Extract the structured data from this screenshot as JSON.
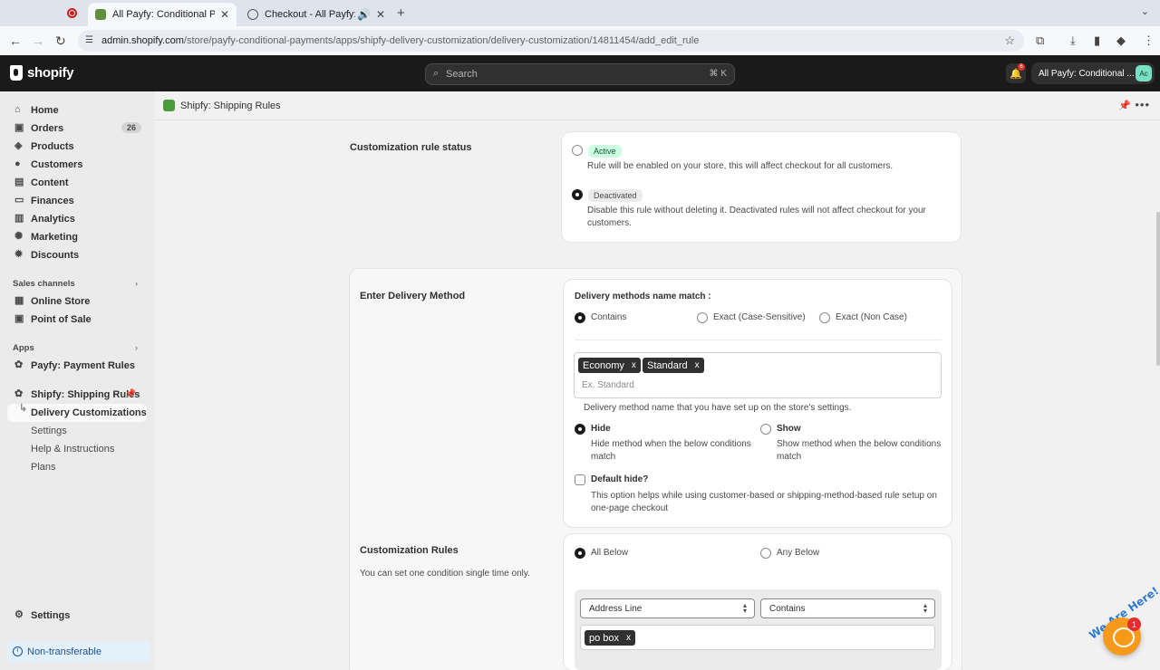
{
  "browser": {
    "tabs": [
      {
        "title": "All Payfy: Conditional Payment",
        "active": true
      },
      {
        "title": "Checkout - All Payfy: Con",
        "active": false
      }
    ],
    "url_host": "admin.shopify.com",
    "url_path": "/store/payfy-conditional-payments/apps/shipfy-delivery-customization/delivery-customization/14811454/add_edit_rule"
  },
  "topbar": {
    "logo_text": "shopify",
    "search_placeholder": "Search",
    "search_shortcut": "⌘ K",
    "notification_count": "6",
    "store_name": "All Payfy: Conditional ...",
    "avatar_initials": "Ac"
  },
  "sidebar": {
    "items": [
      {
        "label": "Home",
        "icon": "home-icon"
      },
      {
        "label": "Orders",
        "icon": "orders-icon",
        "badge": "26"
      },
      {
        "label": "Products",
        "icon": "products-icon"
      },
      {
        "label": "Customers",
        "icon": "customers-icon"
      },
      {
        "label": "Content",
        "icon": "content-icon"
      },
      {
        "label": "Finances",
        "icon": "finances-icon"
      },
      {
        "label": "Analytics",
        "icon": "analytics-icon"
      },
      {
        "label": "Marketing",
        "icon": "marketing-icon"
      },
      {
        "label": "Discounts",
        "icon": "discounts-icon"
      }
    ],
    "sales_channels_label": "Sales channels",
    "sales_channels": [
      {
        "label": "Online Store",
        "icon": "store-icon"
      },
      {
        "label": "Point of Sale",
        "icon": "pos-icon"
      }
    ],
    "apps_label": "Apps",
    "apps": [
      {
        "label": "Payfy: Payment Rules",
        "icon": "payfy-icon"
      },
      {
        "label": "Shipfy: Shipping Rules",
        "icon": "shipfy-icon"
      }
    ],
    "app_subitems": [
      "Delivery Customizations",
      "Settings",
      "Help & Instructions",
      "Plans"
    ],
    "settings_label": "Settings",
    "non_transferable_label": "Non-transferable"
  },
  "app": {
    "title": "Shipfy: Shipping Rules",
    "status_section": {
      "heading": "Customization rule status",
      "active_pill": "Active",
      "active_desc": "Rule will be enabled on your store, this will affect checkout for all customers.",
      "deactivated_pill": "Deactivated",
      "deactivated_desc_1": "Disable this rule without deleting it. Deactivated rules will not affect checkout for your",
      "deactivated_desc_2": "customers.",
      "selected": "Deactivated"
    },
    "delivery_method_section": {
      "heading": "Enter Delivery Method",
      "match_label": "Delivery methods name match :",
      "match_options": [
        "Contains",
        "Exact (Case-Sensitive)",
        "Exact (Non Case)"
      ],
      "match_selected": "Contains",
      "tags": [
        "Economy",
        "Standard"
      ],
      "tag_remove": "x",
      "input_placeholder": "Ex. Standard",
      "helper": "Delivery method name that you have set up on the store's settings.",
      "hide_label": "Hide",
      "hide_desc_1": "Hide method when the below conditions",
      "hide_desc_2": "match",
      "show_label": "Show",
      "show_desc_1": "Show method when the below conditions",
      "show_desc_2": "match",
      "visibility_selected": "Hide",
      "default_hide_label": "Default hide?",
      "default_hide_desc_1": "This option helps while using customer-based or shipping-method-based rule setup on",
      "default_hide_desc_2": "one-page checkout",
      "default_hide_checked": false
    },
    "rules_section": {
      "heading": "Customization Rules",
      "subtext": "You can set one condition single time only.",
      "all_below_label": "All Below",
      "any_below_label": "Any Below",
      "logic_selected": "All Below",
      "field_select": "Address Line",
      "operator_select": "Contains",
      "value_tags": [
        "po box"
      ]
    }
  },
  "chat_widget": {
    "badge": "1",
    "banner": "We Are Here!"
  },
  "colors": {
    "topbar_bg": "#1a1a1a",
    "sidebar_bg": "#ebebeb",
    "active_pill_bg": "#cdfee1",
    "chat_bg": "#f79a1c"
  }
}
